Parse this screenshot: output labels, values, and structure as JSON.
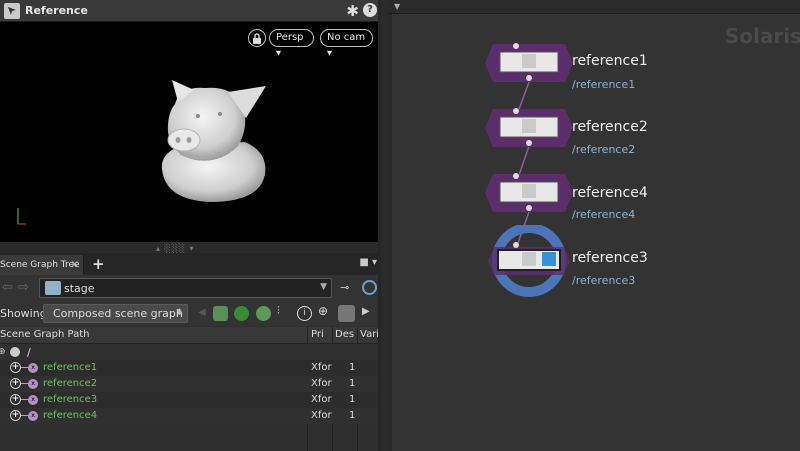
{
  "viewer": {
    "title": "Reference",
    "camera_menu": "Persp",
    "cam_menu": "No cam"
  },
  "scene_graph": {
    "tab_label": "Scene Graph Tree",
    "stage_label": "stage",
    "showing_label": "Showing:",
    "showing_value": "Composed scene graph",
    "columns": [
      "Scene Graph Path",
      "Pri",
      "Des",
      "Vari"
    ],
    "root": "/",
    "rows": [
      {
        "name": "reference1",
        "type": "Xfor",
        "desc": "1"
      },
      {
        "name": "reference2",
        "type": "Xfor",
        "desc": "1"
      },
      {
        "name": "reference3",
        "type": "Xfor",
        "desc": "1"
      },
      {
        "name": "reference4",
        "type": "Xfor",
        "desc": "1"
      }
    ]
  },
  "network": {
    "context_label": "Solaris",
    "nodes": [
      {
        "name": "reference1",
        "path": "/reference1",
        "selected": false
      },
      {
        "name": "reference2",
        "path": "/reference2",
        "selected": false
      },
      {
        "name": "reference4",
        "path": "/reference4",
        "selected": false
      },
      {
        "name": "reference3",
        "path": "/reference3",
        "selected": true
      }
    ]
  },
  "colors": {
    "prim_name": "#6ec35a",
    "node_path": "#8ab4d8",
    "node_ring": "#5b2d6b",
    "selected_ring": "#4d73b8",
    "accent": "#6aa2c9"
  }
}
